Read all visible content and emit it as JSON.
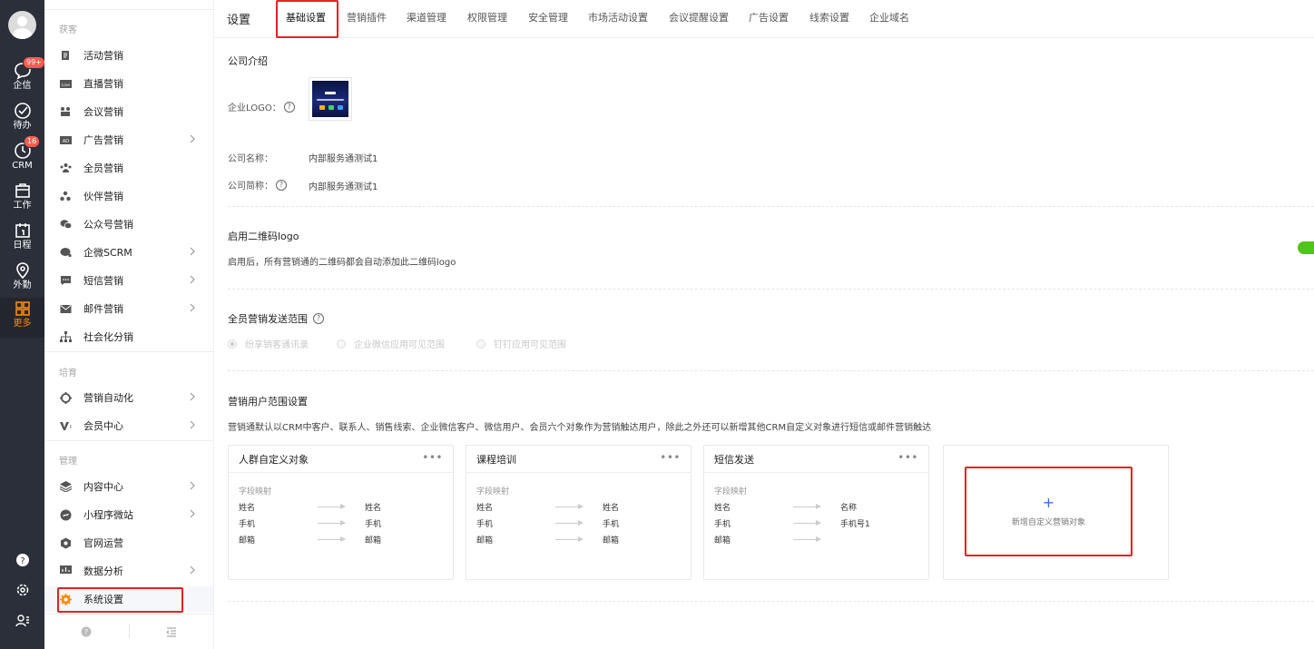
{
  "rail": {
    "items": [
      {
        "label": "企信",
        "badge": "99+",
        "icon": "chat-bubble-icon"
      },
      {
        "label": "待办",
        "icon": "check-circle-icon"
      },
      {
        "label": "CRM",
        "badge": "16",
        "icon": "crm-clock-icon"
      },
      {
        "label": "工作",
        "icon": "briefcase-icon"
      },
      {
        "label": "日程",
        "icon": "calendar-icon"
      },
      {
        "label": "外勤",
        "icon": "location-pin-icon"
      },
      {
        "label": "更多",
        "icon": "grid-icon"
      }
    ],
    "accent_color": "#ff8a00"
  },
  "menu": {
    "groups": [
      {
        "title": "获客",
        "items": [
          {
            "label": "活动营销",
            "chevron": false
          },
          {
            "label": "直播营销",
            "chevron": false
          },
          {
            "label": "会议营销",
            "chevron": false
          },
          {
            "label": "广告营销",
            "chevron": true
          },
          {
            "label": "全员营销",
            "chevron": false
          },
          {
            "label": "伙伴营销",
            "chevron": false
          },
          {
            "label": "公众号营销",
            "chevron": false
          },
          {
            "label": "企微SCRM",
            "chevron": true
          },
          {
            "label": "短信营销",
            "chevron": true
          },
          {
            "label": "邮件营销",
            "chevron": true
          },
          {
            "label": "社会化分销",
            "chevron": false
          }
        ]
      },
      {
        "title": "培育",
        "items": [
          {
            "label": "营销自动化",
            "chevron": true
          },
          {
            "label": "会员中心",
            "chevron": true
          }
        ]
      },
      {
        "title": "管理",
        "items": [
          {
            "label": "内容中心",
            "chevron": true
          },
          {
            "label": "小程序微站",
            "chevron": true
          },
          {
            "label": "官网运营",
            "chevron": false
          },
          {
            "label": "数据分析",
            "chevron": true
          },
          {
            "label": "系统设置",
            "chevron": false
          }
        ]
      }
    ]
  },
  "topbar": {
    "title": "设置",
    "tabs": [
      "基础设置",
      "营销插件",
      "渠道管理",
      "权限管理",
      "安全管理",
      "市场活动设置",
      "会议提醒设置",
      "广告设置",
      "线索设置",
      "企业域名"
    ]
  },
  "company": {
    "section_title": "公司介绍",
    "logo_label": "企业LOGO：",
    "name_label": "公司名称：",
    "name_value": "内部服务通测试1",
    "short_label": "公司简称：",
    "short_value": "内部服务通测试1"
  },
  "qrcode": {
    "title": "启用二维码logo",
    "desc": "启用后，所有营销通的二维码都会自动添加此二维码logo",
    "enabled": true
  },
  "scope": {
    "title": "全员营销发送范围",
    "options": [
      "纷享销客通讯录",
      "企业微信应用可见范围",
      "钉钉应用可见范围"
    ],
    "selected": 0
  },
  "users": {
    "title": "营销用户范围设置",
    "desc": "营销通默认以CRM中客户、联系人、销售线索、企业微信客户、微信用户、会员六个对象作为营销触达用户，除此之外还可以新增其他CRM自定义对象进行短信或邮件营销触达",
    "cards": [
      {
        "title": "人群自定义对象",
        "mapping_label": "字段映射",
        "rows": [
          [
            "姓名",
            "姓名"
          ],
          [
            "手机",
            "手机"
          ],
          [
            "邮箱",
            "邮箱"
          ]
        ]
      },
      {
        "title": "课程培训",
        "mapping_label": "字段映射",
        "rows": [
          [
            "姓名",
            "姓名"
          ],
          [
            "手机",
            "手机"
          ],
          [
            "邮箱",
            "邮箱"
          ]
        ]
      },
      {
        "title": "短信发送",
        "mapping_label": "字段映射",
        "rows": [
          [
            "姓名",
            "名称"
          ],
          [
            "手机",
            "手机号1"
          ],
          [
            "邮箱",
            ""
          ]
        ]
      }
    ],
    "add_label": "新增自定义营销对象",
    "add_plus": "+"
  },
  "highlight_color": "#e52222"
}
